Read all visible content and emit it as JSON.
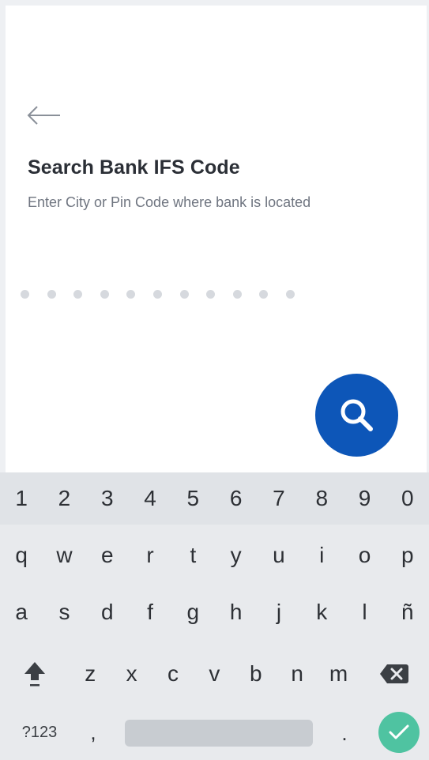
{
  "header": {
    "title": "Search Bank IFS Code",
    "subtitle": "Enter City or Pin Code where bank is located"
  },
  "input": {
    "dot_count": 11
  },
  "keyboard": {
    "numbers": [
      "1",
      "2",
      "3",
      "4",
      "5",
      "6",
      "7",
      "8",
      "9",
      "0"
    ],
    "row1": [
      "q",
      "w",
      "e",
      "r",
      "t",
      "y",
      "u",
      "i",
      "o",
      "p"
    ],
    "row2": [
      "a",
      "s",
      "d",
      "f",
      "g",
      "h",
      "j",
      "k",
      "l",
      "ñ"
    ],
    "row3": [
      "z",
      "x",
      "c",
      "v",
      "b",
      "n",
      "m"
    ],
    "bottom": {
      "symbols_label": "?123",
      "comma": ",",
      "period": "."
    }
  },
  "colors": {
    "fab": "#0d56b8",
    "enter": "#4fc3a1",
    "keyboard_bg": "#e8eaed",
    "number_row_bg": "#e0e3e7"
  },
  "icons": {
    "back": "arrow-left-icon",
    "search": "search-icon",
    "shift": "shift-icon",
    "delete": "backspace-icon",
    "enter": "check-icon"
  }
}
